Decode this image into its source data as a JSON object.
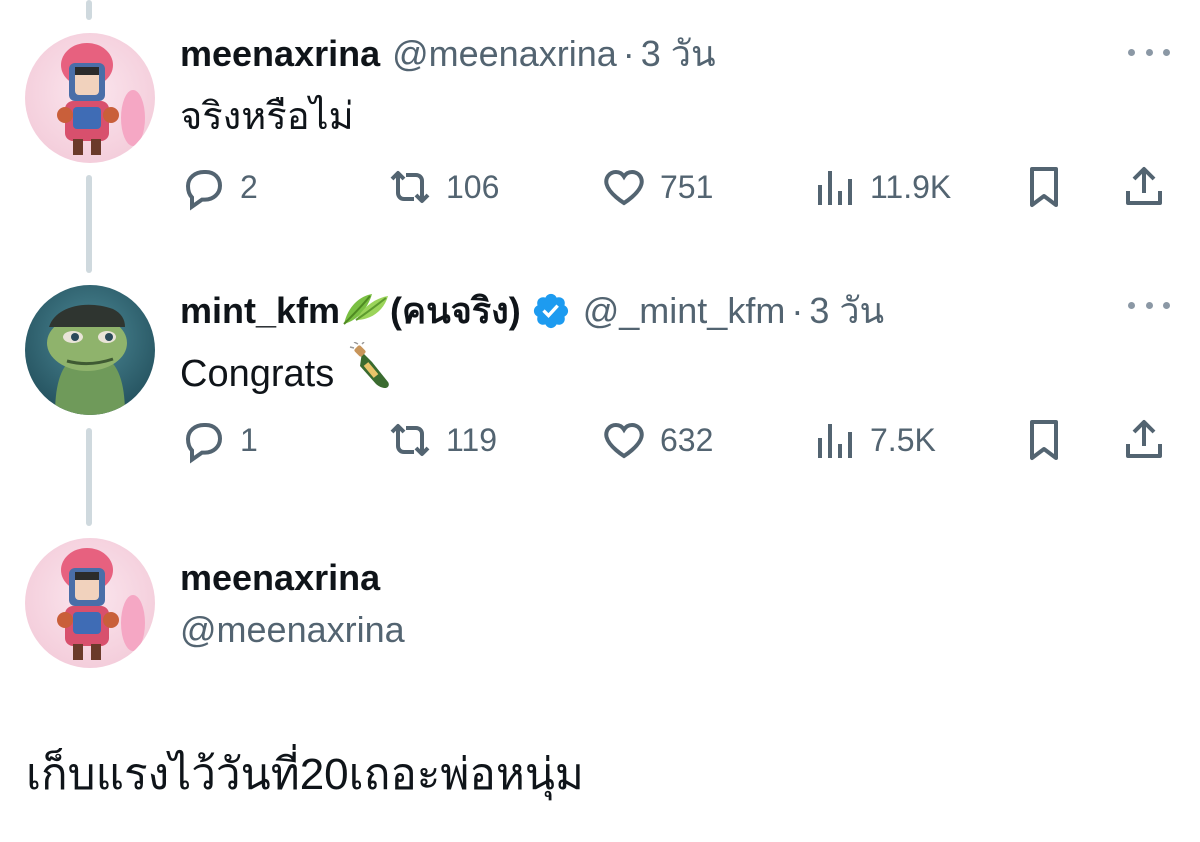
{
  "tweets": [
    {
      "display_name": "meenaxrina",
      "handle": "@meenaxrina",
      "separator": "·",
      "time": "3 วัน",
      "text": "จริงหรือไม่",
      "counts": {
        "replies": "2",
        "retweets": "106",
        "likes": "751",
        "views": "11.9K"
      }
    },
    {
      "display_name": "mint_kfm",
      "name_suffix": "(คนจริง)",
      "handle": "@_mint_kfm",
      "separator": "·",
      "time": "3 วัน",
      "text": "Congrats",
      "counts": {
        "replies": "1",
        "retweets": "119",
        "likes": "632",
        "views": "7.5K"
      }
    }
  ],
  "main_tweet": {
    "display_name": "meenaxrina",
    "handle": "@meenaxrina",
    "text": "เก็บแรงไว้วันที่20เถอะพ่อหนุ่ม"
  },
  "colors": {
    "text": "#0f1419",
    "secondary": "#536471",
    "verified": "#1d9bf0",
    "thread_line": "#cfd9de"
  },
  "icons": [
    "reply-icon",
    "retweet-icon",
    "like-icon",
    "views-icon",
    "bookmark-icon",
    "share-icon",
    "more-icon",
    "verified-icon",
    "leaf-emoji",
    "champagne-emoji"
  ]
}
